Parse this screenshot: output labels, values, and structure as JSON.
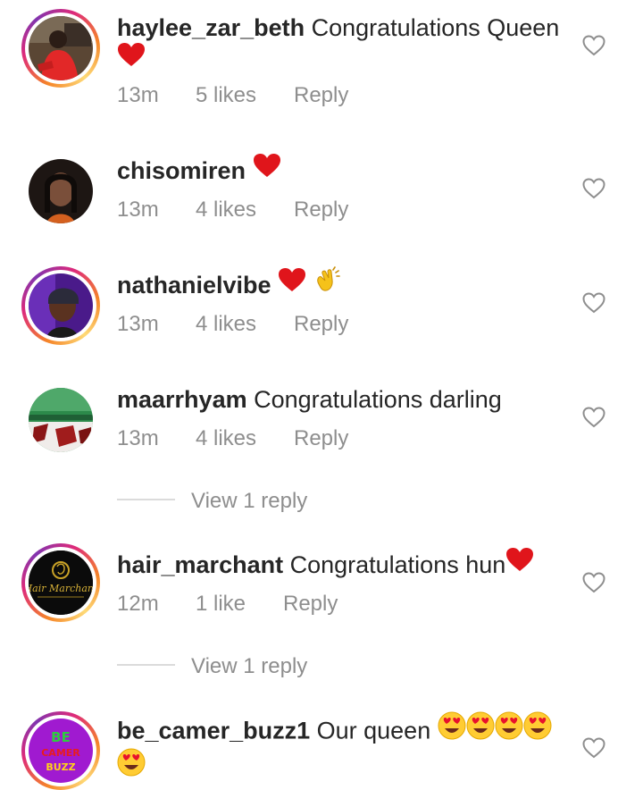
{
  "comments": [
    {
      "username": "haylee_zar_beth",
      "text": "Congratulations Queen",
      "time": "13m",
      "likes": "5 likes",
      "reply": "Reply"
    },
    {
      "username": "chisomiren",
      "text": "",
      "time": "13m",
      "likes": "4 likes",
      "reply": "Reply"
    },
    {
      "username": "nathanielvibe",
      "text": "",
      "time": "13m",
      "likes": "4 likes",
      "reply": "Reply"
    },
    {
      "username": "maarrhyam",
      "text": "Congratulations darling",
      "time": "13m",
      "likes": "4 likes",
      "reply": "Reply",
      "view_replies": "View 1 reply"
    },
    {
      "username": "hair_marchant",
      "text": "Congratulations hun",
      "time": "12m",
      "likes": "1 like",
      "reply": "Reply",
      "view_replies": "View 1 reply"
    },
    {
      "username": "be_camer_buzz1",
      "text": "Our queen"
    }
  ],
  "avatars": {
    "hair_marchant_logo_text": "Hair Marchant",
    "be_camer_buzz_logo": [
      "BE",
      "CAMER",
      "BUZZ"
    ]
  },
  "icons": {
    "like": "heart-outline-icon",
    "red_heart": "red-heart-emoji",
    "clap": "clapping-hands-emoji",
    "heart_eyes": "heart-eyes-emoji"
  },
  "colors": {
    "text": "#262626",
    "secondary": "#8e8e8e",
    "red_heart": "#e0151b",
    "divider": "#dbdbdb"
  }
}
